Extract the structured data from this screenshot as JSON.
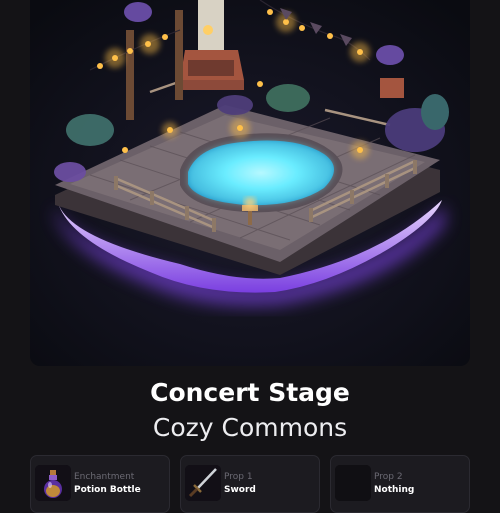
{
  "item": {
    "title": "Concert Stage",
    "subtitle": "Cozy Commons"
  },
  "attributes": [
    {
      "category": "Enchantment",
      "value": "Potion Bottle",
      "icon": "potion-bottle-icon"
    },
    {
      "category": "Prop 1",
      "value": "Sword",
      "icon": "sword-icon"
    },
    {
      "category": "Prop 2",
      "value": "Nothing",
      "icon": "empty-slot-icon"
    }
  ],
  "colors": {
    "background": "#141316",
    "card": "#1c1b20",
    "glow": "#9a5cff",
    "water": "#4fe3ff",
    "lights": "#ffc04a"
  }
}
